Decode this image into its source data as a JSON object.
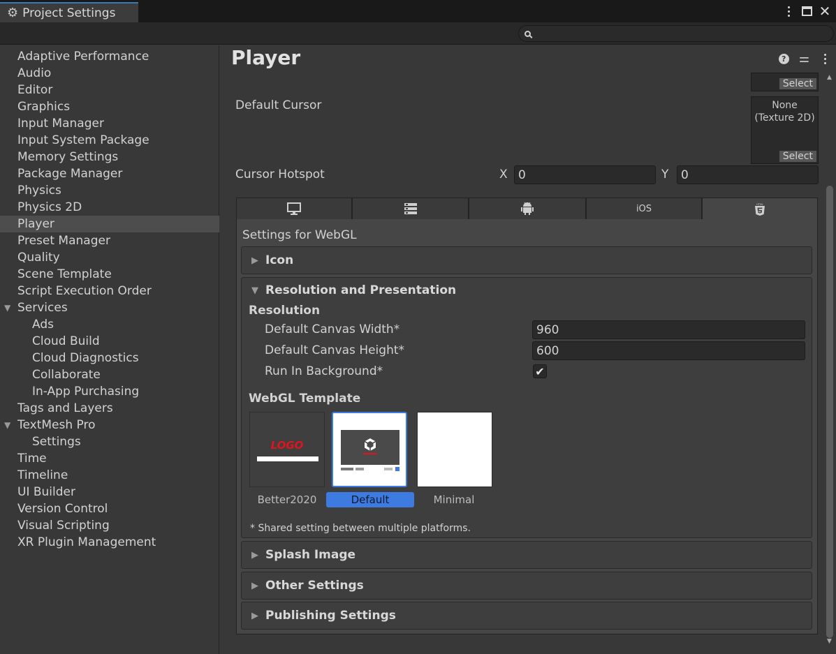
{
  "window": {
    "tab_title": "Project Settings",
    "search_placeholder": ""
  },
  "sidebar": {
    "items": [
      {
        "label": "Adaptive Performance"
      },
      {
        "label": "Audio"
      },
      {
        "label": "Editor"
      },
      {
        "label": "Graphics"
      },
      {
        "label": "Input Manager"
      },
      {
        "label": "Input System Package"
      },
      {
        "label": "Memory Settings"
      },
      {
        "label": "Package Manager"
      },
      {
        "label": "Physics"
      },
      {
        "label": "Physics 2D"
      },
      {
        "label": "Player",
        "selected": true
      },
      {
        "label": "Preset Manager"
      },
      {
        "label": "Quality"
      },
      {
        "label": "Scene Template"
      },
      {
        "label": "Script Execution Order"
      },
      {
        "label": "Services",
        "expanded": true
      },
      {
        "label": "Ads"
      },
      {
        "label": "Cloud Build"
      },
      {
        "label": "Cloud Diagnostics"
      },
      {
        "label": "Collaborate"
      },
      {
        "label": "In-App Purchasing"
      },
      {
        "label": "Tags and Layers"
      },
      {
        "label": "TextMesh Pro",
        "expanded": true
      },
      {
        "label": "Settings"
      },
      {
        "label": "Time"
      },
      {
        "label": "Timeline"
      },
      {
        "label": "UI Builder"
      },
      {
        "label": "Version Control"
      },
      {
        "label": "Visual Scripting"
      },
      {
        "label": "XR Plugin Management"
      }
    ]
  },
  "main": {
    "title": "Player",
    "select_label": "Select",
    "default_cursor": {
      "label": "Default Cursor",
      "value": "None\n(Texture 2D)",
      "select_label": "Select"
    },
    "cursor_hotspot": {
      "label": "Cursor Hotspot",
      "x_label": "X",
      "x_value": "0",
      "y_label": "Y",
      "y_value": "0"
    },
    "platform_tabs": [
      {
        "name": "standalone",
        "icon": "monitor-icon"
      },
      {
        "name": "server",
        "icon": "server-icon"
      },
      {
        "name": "android",
        "icon": "android-icon"
      },
      {
        "name": "ios",
        "label": "iOS"
      },
      {
        "name": "webgl",
        "icon": "html5-icon",
        "active": true
      }
    ],
    "settings_for": "Settings for WebGL",
    "sections": {
      "icon": "Icon",
      "resolution_presentation": "Resolution and Presentation",
      "splash_image": "Splash Image",
      "other_settings": "Other Settings",
      "publishing_settings": "Publishing Settings"
    },
    "resolution": {
      "heading": "Resolution",
      "canvas_width_label": "Default Canvas Width*",
      "canvas_width_value": "960",
      "canvas_height_label": "Default Canvas Height*",
      "canvas_height_value": "600",
      "run_in_background_label": "Run In Background*",
      "run_in_background": true
    },
    "webgl_template": {
      "heading": "WebGL Template",
      "templates": [
        {
          "label": "Better2020",
          "thumb_text": "LOGO"
        },
        {
          "label": "Default",
          "selected": true
        },
        {
          "label": "Minimal"
        }
      ]
    },
    "shared_note": "* Shared setting between multiple platforms."
  },
  "colors": {
    "accent": "#3a79bb",
    "selected_template_label": "#3d7be0",
    "logo_red": "#e0141e"
  }
}
